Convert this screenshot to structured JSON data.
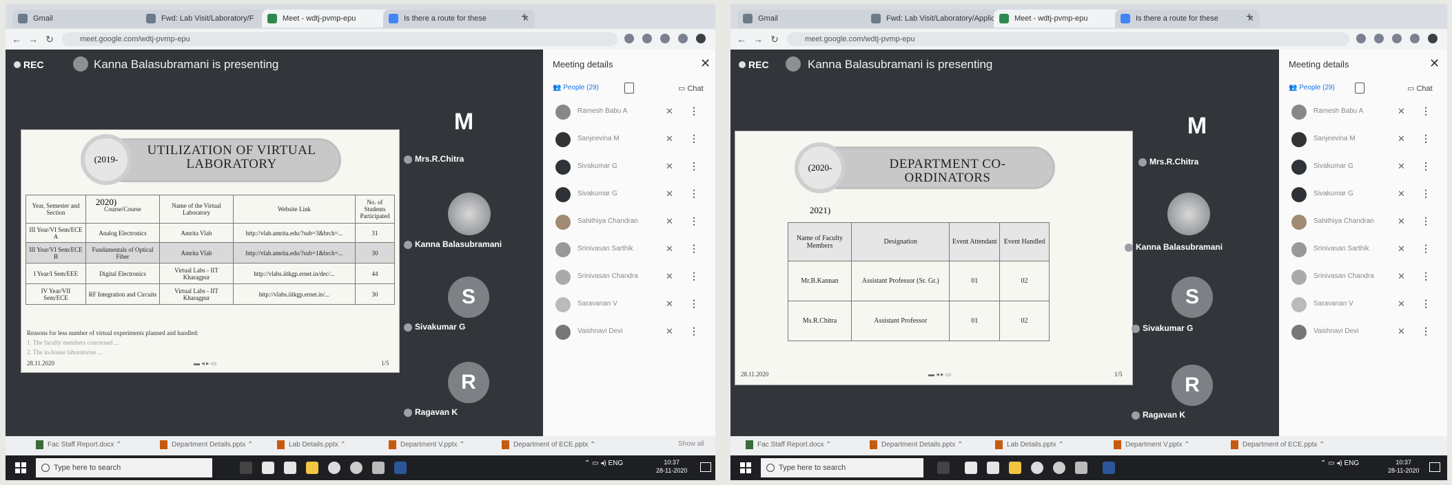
{
  "left": {
    "tabs": [
      {
        "label": "Gmail"
      },
      {
        "label": "Fwd: Lab Visit/Laboratory/F"
      },
      {
        "label": "Meet - wdtj-pvmp-epu"
      },
      {
        "label": "Is there a route for these"
      }
    ],
    "url": "meet.google.com/wdtj-pvmp-epu",
    "rec": "REC",
    "presenting": "Kanna Balasubramani is presenting",
    "slide": {
      "year": "(2019-2020)",
      "title": "UTILIZATION OF VIRTUAL LABORATORY",
      "headers": [
        "Year, Semester and Section",
        "Course/Course",
        "Name of the Virtual Laboratory",
        "Website Link",
        "No. of Students Participated"
      ],
      "rows": [
        [
          "III Year/VI Sem/ECE A",
          "Analog Electronics",
          "Amrita Vlab",
          "http://vlab.amrita.edu/?sub=3&brch=...",
          "31"
        ],
        [
          "III Year/VI Sem/ECE B",
          "Fundamentals of Optical Fiber",
          "Amrita Vlab",
          "http://vlab.amrita.edu/?sub=1&brch=...",
          "30"
        ],
        [
          "I Year/I Sem/EEE",
          "Digital Electronics",
          "Virtual Labs - IIT Kharagpur",
          "http://vlabs.iitkgp.ernet.in/dec/...",
          "44"
        ],
        [
          "IV Year/VII Sem/ECE",
          "RF Integration and Circuits",
          "Virtual Labs - IIT Kharagpur",
          "http://vlabs.iitkgp.ernet.in/...",
          "30"
        ]
      ],
      "notes": [
        "Reasons for less number of virtual experiments planned and handled:",
        "1. The faculty members concerned ...",
        "2. The in-house laboratories ..."
      ],
      "date": "28.11.2020",
      "page": "1/5"
    },
    "tiles": [
      {
        "letter": "M",
        "name": "Mrs.R.Chitra"
      },
      {
        "letter": "",
        "name": "Kanna Balasubramani"
      },
      {
        "letter": "S",
        "name": "Sivakumar G"
      },
      {
        "letter": "R",
        "name": "Ragavan K"
      }
    ],
    "panel": {
      "title": "Meeting details",
      "people_tab": "People (29)",
      "chat_tab": "Chat",
      "people": [
        "Ramesh Babu A",
        "Sanjeevina M",
        "Sivakumar G",
        "Sivakumar G",
        "Sahithiya Chandran",
        "Srinivasan Sarthik",
        "Srinivasan Chandra",
        "Saravanan V",
        "Vaishnavi Devi"
      ]
    },
    "downloads": [
      "Fac Staff Report.docx",
      "Department Details.pptx",
      "Lab Details.pptx",
      "Department V.pptx",
      "Department of ECE.pptx"
    ],
    "show_all": "Show all",
    "search_placeholder": "Type here to search",
    "tray": "ENG",
    "time": "10:37",
    "date": "28-11-2020"
  },
  "right": {
    "tabs": [
      {
        "label": "Gmail"
      },
      {
        "label": "Fwd: Lab Visit/Laboratory/Applica"
      },
      {
        "label": "Meet - wdtj-pvmp-epu"
      },
      {
        "label": "Is there a route for these"
      }
    ],
    "url": "meet.google.com/wdtj-pvmp-epu",
    "rec": "REC",
    "presenting": "Kanna Balasubramani is presenting",
    "slide": {
      "year": "(2020-2021)",
      "title": "DEPARTMENT CO-ORDINATORS",
      "headers": [
        "Name of Faculty Members",
        "Designation",
        "Event Attendant",
        "Event Handled"
      ],
      "rows": [
        [
          "Mr.B.Kannan",
          "Assistant Professor (Sr. Gr.)",
          "01",
          "02"
        ],
        [
          "Ms.R.Chitra",
          "Assistant Professor",
          "01",
          "02"
        ]
      ],
      "date": "28.11.2020",
      "page": "1/5"
    },
    "tiles": [
      {
        "letter": "M",
        "name": "Mrs.R.Chitra"
      },
      {
        "letter": "",
        "name": "Kanna Balasubramani"
      },
      {
        "letter": "S",
        "name": "Sivakumar G"
      },
      {
        "letter": "R",
        "name": "Ragavan K"
      }
    ],
    "panel": {
      "title": "Meeting details",
      "people_tab": "People (29)",
      "chat_tab": "Chat",
      "people": [
        "Ramesh Babu A",
        "Sanjeevina M",
        "Sivakumar G",
        "Sivakumar G",
        "Sahithiya Chandran",
        "Srinivasan Sarthik",
        "Srinivasan Chandra",
        "Saravanan V",
        "Vaishnavi Devi"
      ]
    },
    "downloads": [
      "Fac Staff Report.docx",
      "Department Details.pptx",
      "Lab Details.pptx",
      "Department V.pptx",
      "Department of ECE.pptx"
    ],
    "search_placeholder": "Type here to search",
    "tray": "ENG",
    "time": "10:37",
    "date": "28-11-2020"
  },
  "colors": {
    "meet_bg": "#32363b",
    "panel_bg": "#fafafa",
    "tile_bg": "#7d8185"
  }
}
